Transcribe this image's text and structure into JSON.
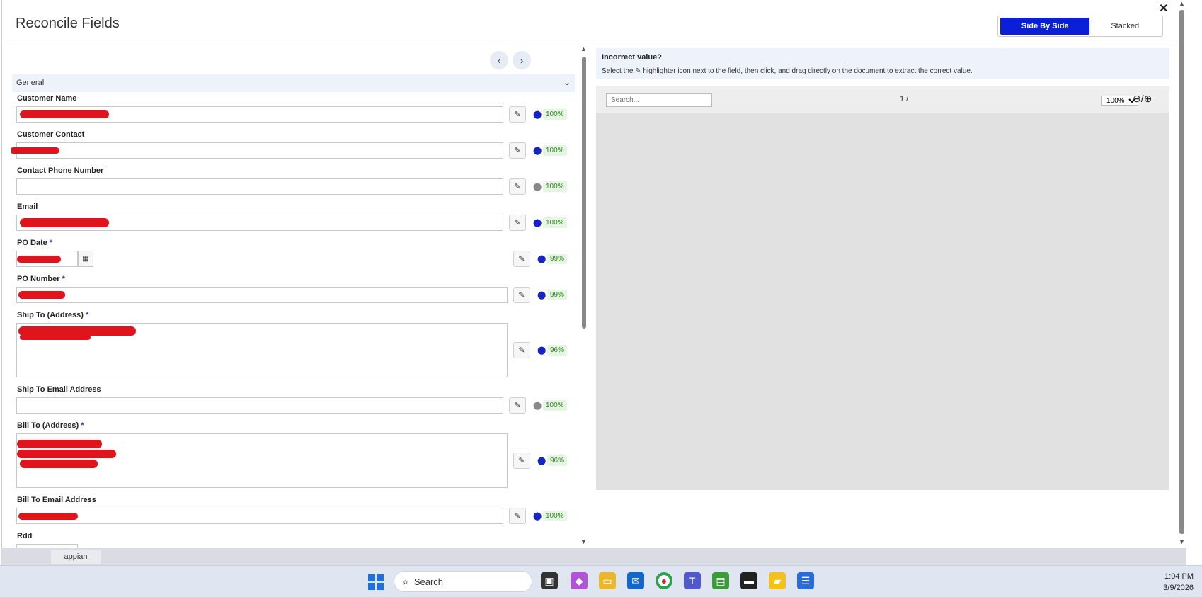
{
  "modal": {
    "title": "Reconcile Fields",
    "view_toggle": {
      "side_by_side": "Side By Side",
      "stacked": "Stacked"
    }
  },
  "form": {
    "section": "General",
    "fields": [
      {
        "label": "Customer Name",
        "required": false,
        "confidence": "100%"
      },
      {
        "label": "Customer Contact",
        "required": false,
        "confidence": "100%"
      },
      {
        "label": "Contact Phone Number",
        "required": false,
        "confidence": "100%"
      },
      {
        "label": "Email",
        "required": false,
        "confidence": "100%"
      },
      {
        "label": "PO Date",
        "required": true,
        "confidence": "99%"
      },
      {
        "label": "PO Number",
        "required": true,
        "confidence": "99%"
      },
      {
        "label": "Ship To (Address)",
        "required": true,
        "confidence": "96%"
      },
      {
        "label": "Ship To Email Address",
        "required": false,
        "confidence": "100%"
      },
      {
        "label": "Bill To (Address)",
        "required": true,
        "confidence": "96%"
      },
      {
        "label": "Bill To Email Address",
        "required": false,
        "confidence": "100%"
      },
      {
        "label": "Rdd",
        "required": false,
        "confidence": ""
      }
    ],
    "required_marker": "*"
  },
  "hint": {
    "title": "Incorrect value?",
    "description": "Select the ✎ highlighter icon next to the field, then click, and drag directly on the document to extract the correct value."
  },
  "viewer": {
    "search_placeholder": "Search...",
    "page_count": "1 /",
    "zoom": "100%",
    "zoom_options": [
      "100%"
    ]
  },
  "taskbar": {
    "app_tab": "appian",
    "search_label": "Search",
    "time": "1:04 PM",
    "date": "3/9/2026"
  },
  "icons": {
    "close": "close-icon",
    "pencil": "pencil-icon",
    "pin": "map-pin-icon",
    "calendar": "calendar-icon"
  },
  "colors": {
    "accent": "#0a1fd6",
    "confidence_bg": "#e7f6e4",
    "confidence_text": "#2b8a1d",
    "redaction": "#e0141d"
  }
}
